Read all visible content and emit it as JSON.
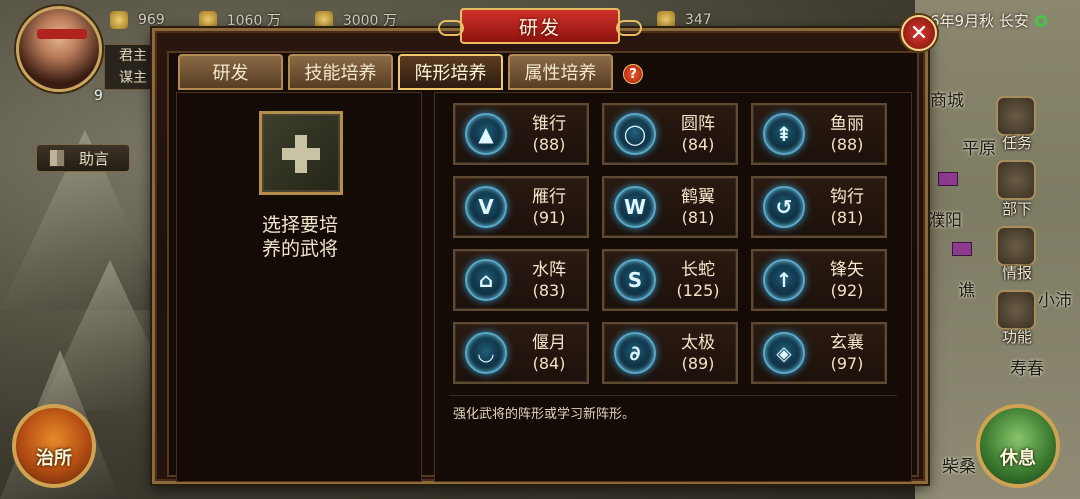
{
  "topbar": {
    "resources": [
      {
        "icon": "grain-icon",
        "value": "969"
      },
      {
        "icon": "coin-icon",
        "value": "1060 万"
      },
      {
        "icon": "soldier-icon",
        "value": "3000 万"
      },
      {
        "icon": "scroll-icon",
        "value": "347"
      }
    ],
    "date_text": "6年9月秋 长安"
  },
  "player": {
    "level": "9",
    "roles": [
      "君主",
      "谋主"
    ]
  },
  "helper_label": "助言",
  "map": {
    "cities": [
      "商城",
      "平原",
      "濮阳",
      "谯",
      "小沛",
      "寿春",
      "柴桑"
    ],
    "menu": [
      "任务",
      "部下",
      "情报",
      "功能"
    ]
  },
  "buttons": {
    "govern": "治所",
    "rest": "休息",
    "close": "✕"
  },
  "dialog": {
    "title": "研发",
    "tabs": [
      {
        "label": "研发",
        "active": false
      },
      {
        "label": "技能培养",
        "active": false
      },
      {
        "label": "阵形培养",
        "active": true
      },
      {
        "label": "属性培养",
        "active": false
      }
    ],
    "help": "?",
    "select_text": [
      "选择要培",
      "养的武将"
    ],
    "formations": [
      {
        "name": "锥行",
        "level": "(88)",
        "glyph": "▲"
      },
      {
        "name": "圆阵",
        "level": "(84)",
        "glyph": "◯"
      },
      {
        "name": "鱼丽",
        "level": "(88)",
        "glyph": "⇞"
      },
      {
        "name": "雁行",
        "level": "(91)",
        "glyph": "V"
      },
      {
        "name": "鹤翼",
        "level": "(81)",
        "glyph": "W"
      },
      {
        "name": "钩行",
        "level": "(81)",
        "glyph": "↺"
      },
      {
        "name": "水阵",
        "level": "(83)",
        "glyph": "⌂"
      },
      {
        "name": "长蛇",
        "level": "(125)",
        "glyph": "S"
      },
      {
        "name": "锋矢",
        "level": "(92)",
        "glyph": "↑"
      },
      {
        "name": "偃月",
        "level": "(84)",
        "glyph": "◡"
      },
      {
        "name": "太极",
        "level": "(89)",
        "glyph": "∂"
      },
      {
        "name": "玄襄",
        "level": "(97)",
        "glyph": "◈"
      }
    ],
    "description": "强化武将的阵形或学习新阵形。"
  }
}
